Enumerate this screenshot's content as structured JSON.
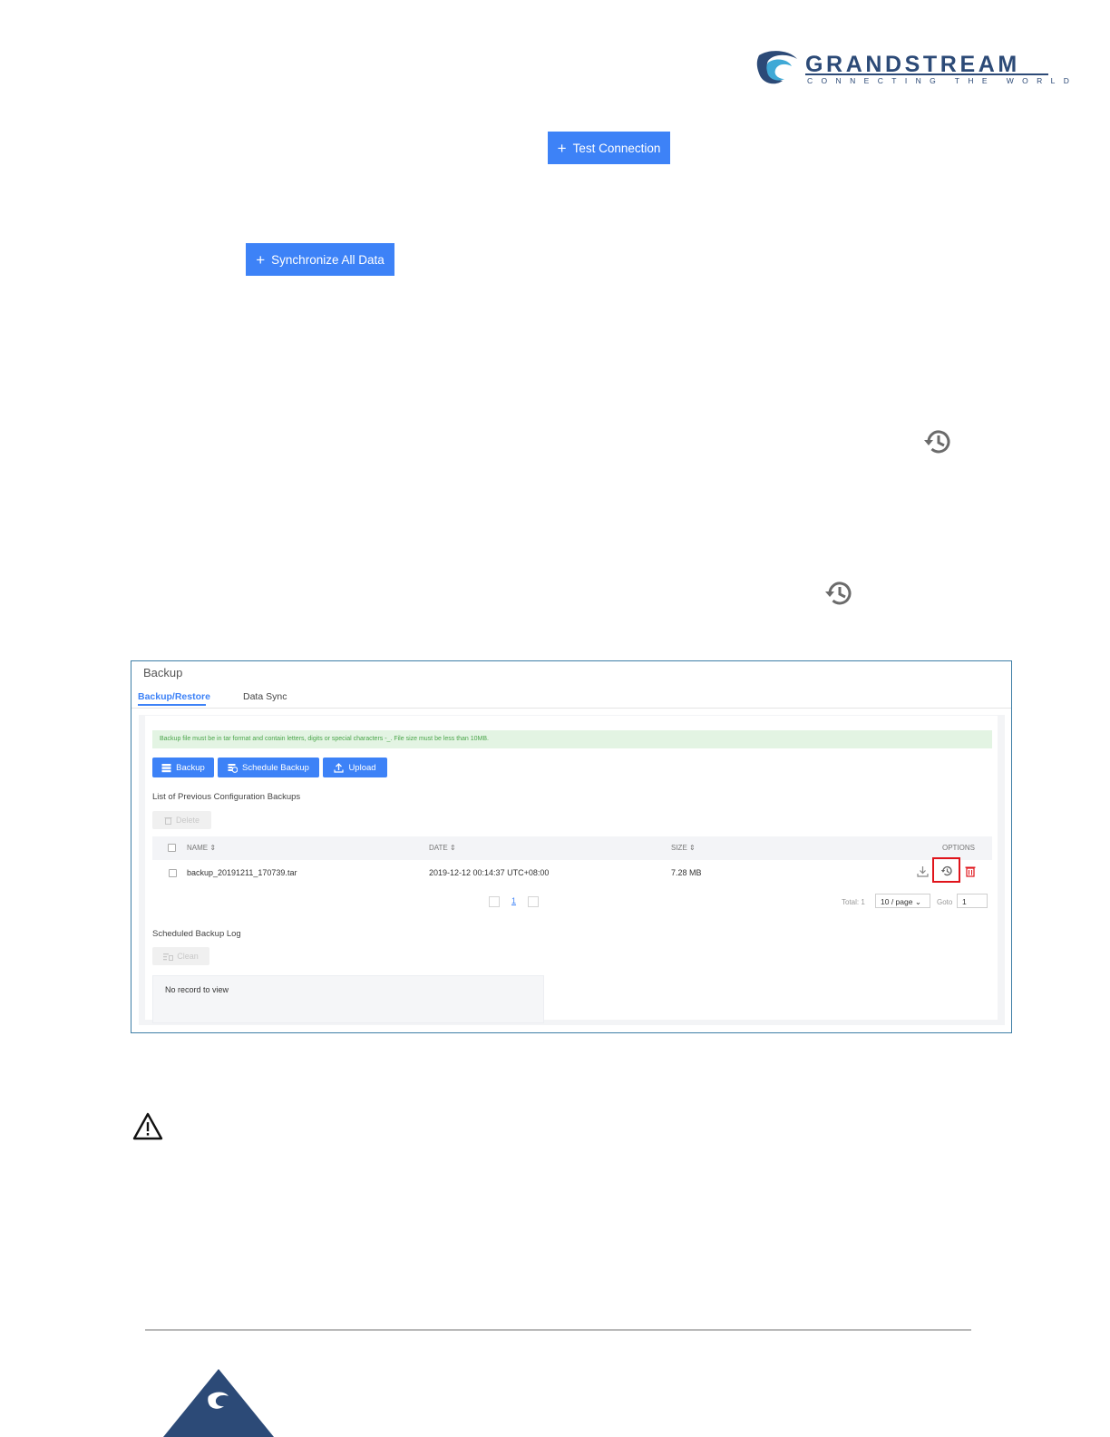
{
  "logo": {
    "name": "GRANDSTREAM",
    "tagline": "CONNECTING THE WORLD"
  },
  "buttons": {
    "test_connection": "Test Connection",
    "synchronize_all_data": "Synchronize All Data"
  },
  "backup_ui": {
    "title": "Backup",
    "tabs": [
      {
        "label": "Backup/Restore",
        "active": true
      },
      {
        "label": "Data Sync",
        "active": false
      }
    ],
    "notice": "Backup file must be in tar format and contain letters, digits or special characters -_. File size must be less than 10MB.",
    "actions": {
      "backup": "Backup",
      "schedule_backup": "Schedule Backup",
      "upload": "Upload"
    },
    "previous_backups_label": "List of Previous Configuration Backups",
    "delete_label": "Delete",
    "table": {
      "headers": {
        "name": "NAME",
        "date": "DATE",
        "size": "SIZE",
        "options": "OPTIONS"
      },
      "rows": [
        {
          "name": "backup_20191211_170739.tar",
          "date": "2019-12-12 00:14:37 UTC+08:00",
          "size": "7.28 MB"
        }
      ]
    },
    "pagination": {
      "page": "1",
      "total": "Total: 1",
      "per_page": "10 / page",
      "goto_label": "Goto",
      "goto_value": "1"
    },
    "scheduled_log_label": "Scheduled Backup Log",
    "clean_label": "Clean",
    "empty_log": "No record to view"
  },
  "colors": {
    "primary": "#3d82f7",
    "highlight": "#e0141b",
    "brand": "#2c4a77"
  }
}
